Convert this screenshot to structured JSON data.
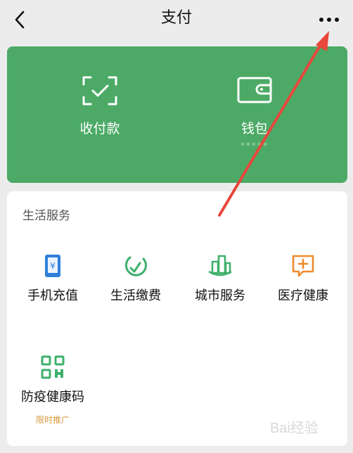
{
  "header": {
    "title": "支付",
    "back_icon": "chevron-left-icon",
    "more_icon": "more-dots-icon"
  },
  "wallet_card": {
    "accent_color": "#4caa66",
    "items": [
      {
        "label": "收付款",
        "icon": "scan-check-icon"
      },
      {
        "label": "钱包",
        "icon": "wallet-icon",
        "balance_mask": "*****"
      }
    ]
  },
  "services": {
    "section_title": "生活服务",
    "items": [
      {
        "label": "手机充值",
        "icon": "phone-recharge-icon"
      },
      {
        "label": "生活缴费",
        "icon": "bill-payment-icon"
      },
      {
        "label": "城市服务",
        "icon": "city-service-icon"
      },
      {
        "label": "医疗健康",
        "icon": "medical-health-icon"
      },
      {
        "label": "防疫健康码",
        "icon": "qr-code-icon",
        "promo": "限时推广"
      }
    ]
  },
  "annotation": {
    "arrow_color": "#e8473d"
  },
  "watermark": {
    "text": "Bai经验"
  }
}
